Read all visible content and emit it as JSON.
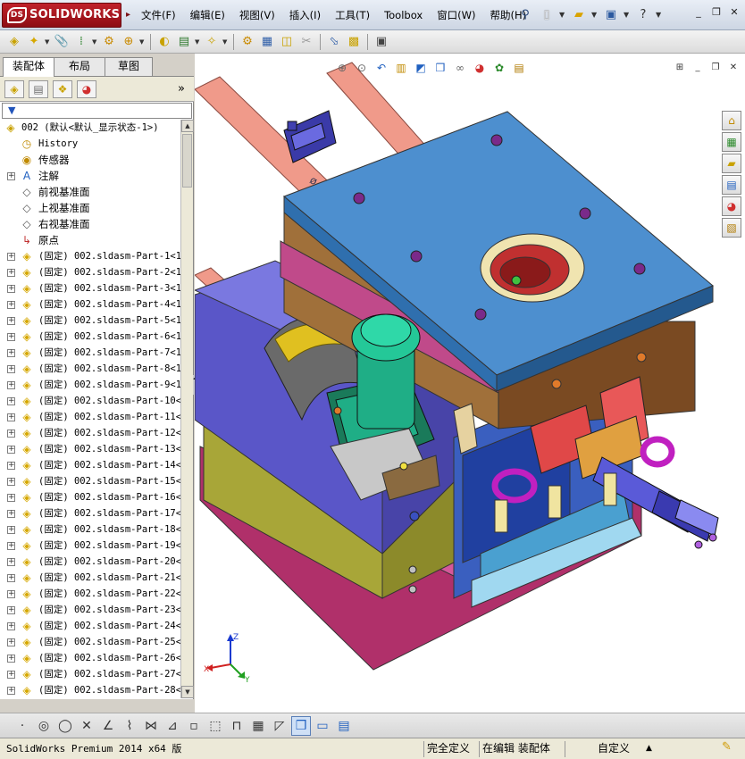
{
  "app": {
    "logo_text": "SOLIDWORKS",
    "logo_mark": "DS",
    "menus": [
      "文件(F)",
      "编辑(E)",
      "视图(V)",
      "插入(I)",
      "工具(T)",
      "Toolbox",
      "窗口(W)",
      "帮助(H)"
    ]
  },
  "panel": {
    "tabs": [
      "装配体",
      "布局",
      "草图"
    ],
    "tree": {
      "root": "002  (默认<默认_显示状态-1>)",
      "fixed_items": [
        {
          "label": "History",
          "icon": "history-icon",
          "mono": true,
          "expander": false
        },
        {
          "label": "传感器",
          "icon": "sensor-icon",
          "mono": false,
          "expander": false
        },
        {
          "label": "注解",
          "icon": "annotation-icon",
          "mono": false,
          "expander": true
        },
        {
          "label": "前视基准面",
          "icon": "plane-icon",
          "mono": false,
          "expander": false
        },
        {
          "label": "上视基准面",
          "icon": "plane-icon",
          "mono": false,
          "expander": false
        },
        {
          "label": "右视基准面",
          "icon": "plane-icon",
          "mono": false,
          "expander": false
        },
        {
          "label": "原点",
          "icon": "origin-icon",
          "mono": false,
          "expander": false
        }
      ],
      "parts": [
        "(固定) 002.sldasm-Part-1<1",
        "(固定) 002.sldasm-Part-2<1",
        "(固定) 002.sldasm-Part-3<1",
        "(固定) 002.sldasm-Part-4<1",
        "(固定) 002.sldasm-Part-5<1",
        "(固定) 002.sldasm-Part-6<1",
        "(固定) 002.sldasm-Part-7<1",
        "(固定) 002.sldasm-Part-8<1",
        "(固定) 002.sldasm-Part-9<1",
        "(固定) 002.sldasm-Part-10<",
        "(固定) 002.sldasm-Part-11<",
        "(固定) 002.sldasm-Part-12<",
        "(固定) 002.sldasm-Part-13<",
        "(固定) 002.sldasm-Part-14<",
        "(固定) 002.sldasm-Part-15<",
        "(固定) 002.sldasm-Part-16<",
        "(固定) 002.sldasm-Part-17<",
        "(固定) 002.sldasm-Part-18<",
        "(固定) 002.sldasm-Part-19<",
        "(固定) 002.sldasm-Part-20<",
        "(固定) 002.sldasm-Part-21<",
        "(固定) 002.sldasm-Part-22<",
        "(固定) 002.sldasm-Part-23<",
        "(固定) 002.sldasm-Part-24<",
        "(固定) 002.sldasm-Part-25<",
        "(固定) 002.sldasm-Part-26<",
        "(固定) 002.sldasm-Part-27<",
        "(固定) 002.sldasm-Part-28<"
      ]
    }
  },
  "model": {
    "engraving": "Ø"
  },
  "triad": {
    "x": "X",
    "y": "Y",
    "z": "Z"
  },
  "status": {
    "version": "SolidWorks Premium 2014 x64 版",
    "definition": "完全定义",
    "editing": "在编辑 装配体",
    "units": "自定义",
    "units_arrow": "▲"
  },
  "colors": {
    "logo_red": "#c0212b",
    "plate_blue": "#4d8fcf",
    "plate_brown": "#8a5a2a",
    "plate_purple": "#5a56c8",
    "plate_olive": "#8c8a2a",
    "cylinder_salmon": "#f09a8a",
    "motor_teal": "#1fae86"
  }
}
